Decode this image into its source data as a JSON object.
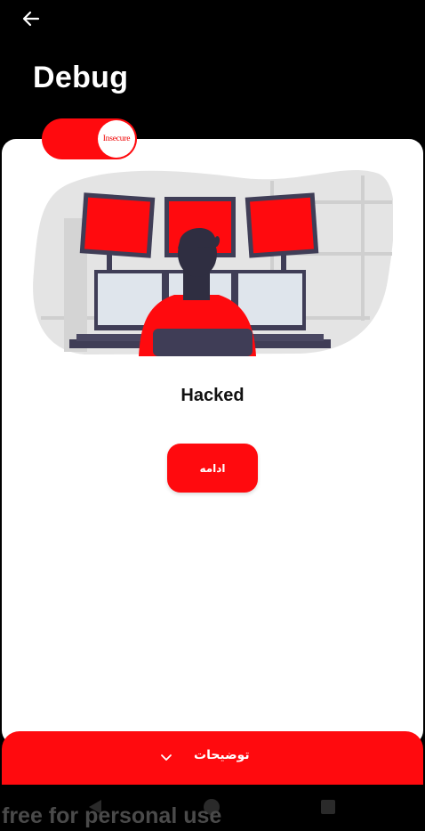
{
  "header": {
    "back_icon": "arrow-left-icon",
    "title": "Debug"
  },
  "badge": {
    "label": "Insecure",
    "color": "#ff0a0e"
  },
  "main": {
    "illustration": "hacker-at-monitors-illustration",
    "status": "Hacked",
    "continue_label": "ادامه"
  },
  "bottom_bar": {
    "label": "توضیحات",
    "icon": "chevron-down-icon"
  },
  "system_nav": {
    "back": "nav-back-icon",
    "home": "nav-home-icon",
    "recents": "nav-recents-icon"
  },
  "watermark": "free for personal use",
  "colors": {
    "accent": "#ff0a0e",
    "background": "#000000",
    "card": "#ffffff"
  }
}
